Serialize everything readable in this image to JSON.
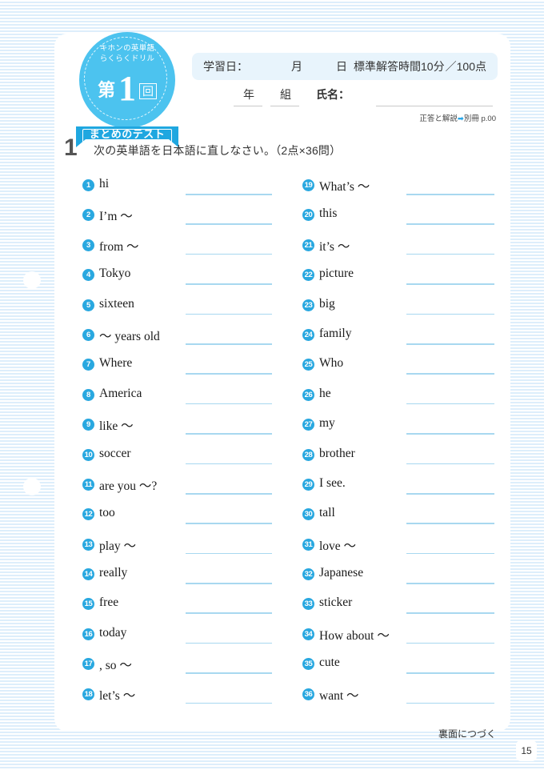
{
  "background": {
    "stripe_color": "#ddeefb",
    "page_color": "#ffffff"
  },
  "badge": {
    "subtitle_line1": "キホンの英単語",
    "subtitle_line2": "らくらくドリル",
    "dai": "第",
    "number": "1",
    "kai": "回",
    "ribbon_label": "まとめのテスト",
    "circle_color": "#4cc3ef",
    "ribbon_color": "#1fa7e0"
  },
  "header": {
    "study_date_label": "学習日：",
    "month_label": "月",
    "day_label": "日",
    "time_limit": "標準解答時間10分",
    "score": "／100点",
    "year_label": "年",
    "class_label": "組",
    "name_label": "氏名：",
    "bar_color": "#e8f4fc"
  },
  "answer_ref": {
    "text_before": "正答と解説",
    "arrow": "➡",
    "text_after": "別冊 p.00",
    "arrow_color": "#2aa7e8"
  },
  "question": {
    "number": "1",
    "instruction": "次の英単語を日本語に直しなさい。（2点×36問）"
  },
  "items_left": [
    {
      "n": "1",
      "word": "hi"
    },
    {
      "n": "2",
      "word": "I’m ～"
    },
    {
      "n": "3",
      "word": "from ～"
    },
    {
      "n": "4",
      "word": "Tokyo"
    },
    {
      "n": "5",
      "word": "sixteen"
    },
    {
      "n": "6",
      "word": "～ years old"
    },
    {
      "n": "7",
      "word": "Where"
    },
    {
      "n": "8",
      "word": "America"
    },
    {
      "n": "9",
      "word": "like ～"
    },
    {
      "n": "10",
      "word": "soccer"
    },
    {
      "n": "11",
      "word": "are you ～?"
    },
    {
      "n": "12",
      "word": "too"
    },
    {
      "n": "13",
      "word": "play ～"
    },
    {
      "n": "14",
      "word": "really"
    },
    {
      "n": "15",
      "word": "free"
    },
    {
      "n": "16",
      "word": "today"
    },
    {
      "n": "17",
      "word": ", so ～"
    },
    {
      "n": "18",
      "word": "let’s ～"
    }
  ],
  "items_right": [
    {
      "n": "19",
      "word": "What’s ～"
    },
    {
      "n": "20",
      "word": "this"
    },
    {
      "n": "21",
      "word": "it’s ～"
    },
    {
      "n": "22",
      "word": "picture"
    },
    {
      "n": "23",
      "word": "big"
    },
    {
      "n": "24",
      "word": "family"
    },
    {
      "n": "25",
      "word": "Who"
    },
    {
      "n": "26",
      "word": "he"
    },
    {
      "n": "27",
      "word": "my"
    },
    {
      "n": "28",
      "word": "brother"
    },
    {
      "n": "29",
      "word": "I see."
    },
    {
      "n": "30",
      "word": "tall"
    },
    {
      "n": "31",
      "word": "love ～"
    },
    {
      "n": "32",
      "word": "Japanese"
    },
    {
      "n": "33",
      "word": "sticker"
    },
    {
      "n": "34",
      "word": "How about ～"
    },
    {
      "n": "35",
      "word": "cute"
    },
    {
      "n": "36",
      "word": "want ～"
    }
  ],
  "footer": {
    "continue_note": "裏面につづく",
    "page_number": "15"
  },
  "colors": {
    "accent_blue": "#29a8e0",
    "line_blue": "#a8d8f0",
    "badge_blue": "#4cc3ef"
  }
}
